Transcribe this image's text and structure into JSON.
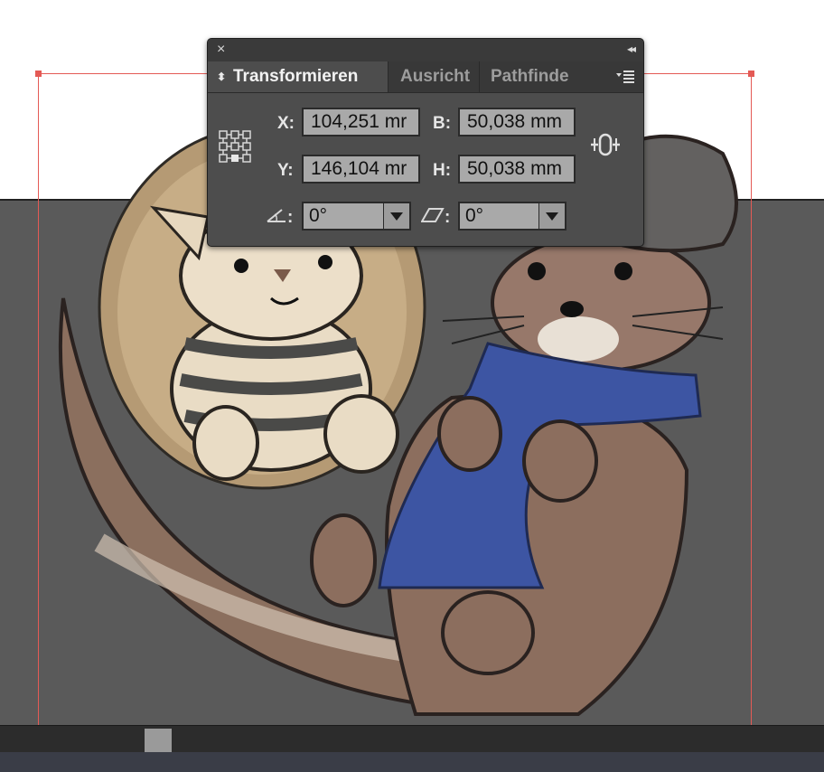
{
  "panel": {
    "close_glyph": "×",
    "collapse_glyph": "◂◂",
    "tabs": [
      {
        "label": "Transformieren",
        "active": true
      },
      {
        "label": "Ausricht",
        "active": false
      },
      {
        "label": "Pathfinde",
        "active": false
      }
    ],
    "fields": {
      "x": {
        "label": "X:",
        "value": "104,251 mr"
      },
      "y": {
        "label": "Y:",
        "value": "146,104 mr"
      },
      "w": {
        "label": "B:",
        "value": "50,038 mm"
      },
      "h": {
        "label": "H:",
        "value": "50,038 mm"
      },
      "rotate": {
        "label": ":",
        "value": "0°"
      },
      "shear": {
        "label": ":",
        "value": "0°"
      }
    },
    "icons": {
      "reference_point": "reference-point-grid-icon",
      "constrain": "constrain-proportions-link-icon",
      "rotate": "rotate-angle-icon",
      "shear": "shear-icon",
      "menu": "panel-menu-icon"
    }
  },
  "colors": {
    "selection": "#e45a55",
    "artboard": "#5a5a5a",
    "panel_bg": "#4d4d4d",
    "field_bg": "#a9a9a9"
  }
}
